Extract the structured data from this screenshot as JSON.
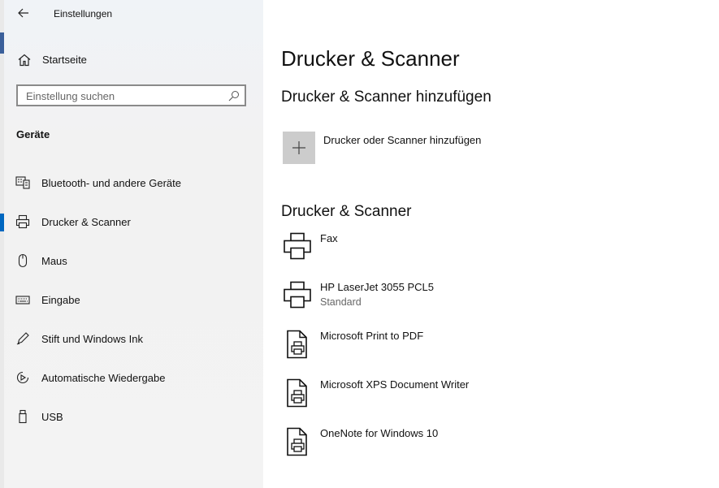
{
  "window": {
    "title": "Einstellungen"
  },
  "sidebar": {
    "home_label": "Startseite",
    "search_placeholder": "Einstellung suchen",
    "section_title": "Geräte",
    "items": [
      {
        "label": "Bluetooth- und andere Geräte",
        "icon": "bluetooth-devices-icon"
      },
      {
        "label": "Drucker & Scanner",
        "icon": "printer-icon"
      },
      {
        "label": "Maus",
        "icon": "mouse-icon"
      },
      {
        "label": "Eingabe",
        "icon": "keyboard-icon"
      },
      {
        "label": "Stift und Windows Ink",
        "icon": "pen-icon"
      },
      {
        "label": "Automatische Wiedergabe",
        "icon": "autoplay-icon"
      },
      {
        "label": "USB",
        "icon": "usb-icon"
      }
    ],
    "active_index": 1
  },
  "main": {
    "page_title": "Drucker & Scanner",
    "add_section_title": "Drucker & Scanner hinzufügen",
    "add_label": "Drucker oder Scanner hinzufügen",
    "list_section_title": "Drucker & Scanner",
    "printers": [
      {
        "name": "Fax",
        "status": "",
        "icon": "printer-icon"
      },
      {
        "name": "HP LaserJet 3055 PCL5",
        "status": "Standard",
        "icon": "printer-icon"
      },
      {
        "name": "Microsoft Print to PDF",
        "status": "",
        "icon": "document-printer-icon"
      },
      {
        "name": "Microsoft XPS Document Writer",
        "status": "",
        "icon": "document-printer-icon"
      },
      {
        "name": "OneNote for Windows 10",
        "status": "",
        "icon": "document-printer-icon"
      }
    ]
  },
  "colors": {
    "accent": "#0067c0",
    "sidebar_bg": "#f3f3f3",
    "tile_bg": "#cccccc"
  }
}
